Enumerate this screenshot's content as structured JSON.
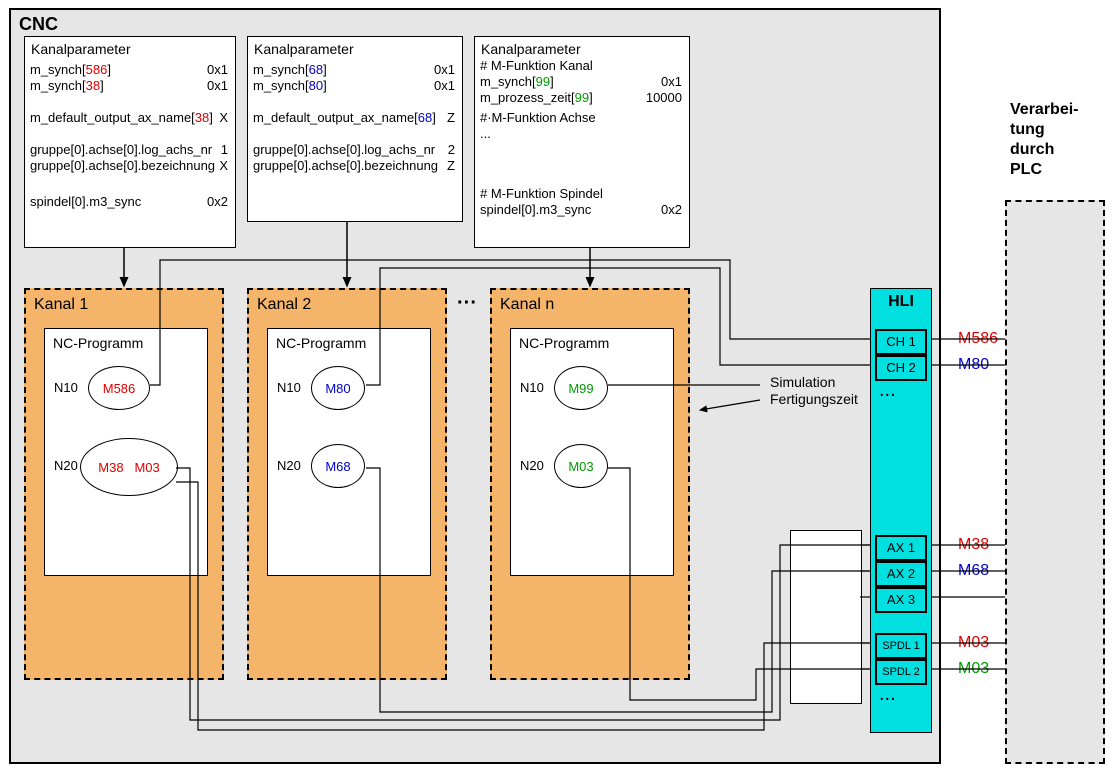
{
  "cnc": {
    "title": "CNC"
  },
  "params": [
    {
      "title": "Kanalparameter",
      "lines": [
        {
          "parts": [
            {
              "t": "m_synch[",
              "c": ""
            },
            {
              "t": "586",
              "c": "red"
            },
            {
              "t": "]",
              "c": ""
            }
          ],
          "val": "0x1"
        },
        {
          "parts": [
            {
              "t": "m_synch[",
              "c": ""
            },
            {
              "t": "38",
              "c": "red"
            },
            {
              "t": "]",
              "c": ""
            }
          ],
          "val": "0x1"
        },
        {
          "parts": [
            {
              "t": "m_default_output_ax_name[",
              "c": ""
            },
            {
              "t": "38",
              "c": "red"
            },
            {
              "t": "]",
              "c": ""
            }
          ],
          "val": "X"
        },
        {
          "parts": [
            {
              "t": "gruppe[0].achse[0].log_achs_nr",
              "c": ""
            }
          ],
          "val": "1"
        },
        {
          "parts": [
            {
              "t": "gruppe[0].achse[0].bezeichnung",
              "c": ""
            }
          ],
          "val": "X"
        },
        {
          "parts": [
            {
              "t": "spindel[0].m3_sync",
              "c": ""
            }
          ],
          "val": "0x2"
        }
      ]
    },
    {
      "title": "Kanalparameter",
      "lines": [
        {
          "parts": [
            {
              "t": "m_synch[",
              "c": ""
            },
            {
              "t": "68",
              "c": "blue"
            },
            {
              "t": "]",
              "c": ""
            }
          ],
          "val": "0x1"
        },
        {
          "parts": [
            {
              "t": "m_synch[",
              "c": ""
            },
            {
              "t": "80",
              "c": "blue"
            },
            {
              "t": "]",
              "c": ""
            }
          ],
          "val": "0x1"
        },
        {
          "parts": [
            {
              "t": "m_default_output_ax_name[",
              "c": ""
            },
            {
              "t": "68",
              "c": "blue"
            },
            {
              "t": "]",
              "c": ""
            }
          ],
          "val": "Z"
        },
        {
          "parts": [
            {
              "t": "gruppe[0].achse[0].log_achs_nr",
              "c": ""
            }
          ],
          "val": "2"
        },
        {
          "parts": [
            {
              "t": "gruppe[0].achse[0].bezeichnung",
              "c": ""
            }
          ],
          "val": "Z"
        }
      ]
    },
    {
      "title": "Kanalparameter",
      "lines": [
        {
          "parts": [
            {
              "t": "# M-Funktion Kanal",
              "c": ""
            }
          ],
          "val": ""
        },
        {
          "parts": [
            {
              "t": "m_synch[",
              "c": ""
            },
            {
              "t": "99",
              "c": "green"
            },
            {
              "t": "]",
              "c": ""
            }
          ],
          "val": "0x1"
        },
        {
          "parts": [
            {
              "t": "m_prozess_zeit[",
              "c": ""
            },
            {
              "t": "99",
              "c": "green"
            },
            {
              "t": "]",
              "c": ""
            }
          ],
          "val": "10000"
        },
        {
          "parts": [
            {
              "t": "#·M-Funktion Achse",
              "c": ""
            }
          ],
          "val": ""
        },
        {
          "parts": [
            {
              "t": "...",
              "c": ""
            }
          ],
          "val": ""
        },
        {
          "parts": [
            {
              "t": "# M-Funktion Spindel",
              "c": ""
            }
          ],
          "val": ""
        },
        {
          "parts": [
            {
              "t": "spindel[0].m3_sync",
              "c": ""
            }
          ],
          "val": "0x2"
        }
      ]
    }
  ],
  "kanals": [
    {
      "title": "Kanal 1",
      "nc": "NC-Programm",
      "rows": [
        {
          "n": "N10",
          "codes": [
            {
              "t": "M586",
              "c": "red"
            }
          ]
        },
        {
          "n": "N20",
          "codes": [
            {
              "t": "M38",
              "c": "red"
            },
            {
              "t": "M03",
              "c": "red"
            }
          ]
        }
      ]
    },
    {
      "title": "Kanal 2",
      "nc": "NC-Programm",
      "rows": [
        {
          "n": "N10",
          "codes": [
            {
              "t": "M80",
              "c": "blue"
            }
          ]
        },
        {
          "n": "N20",
          "codes": [
            {
              "t": "M68",
              "c": "blue"
            }
          ]
        }
      ]
    },
    {
      "title": "Kanal n",
      "nc": "NC-Programm",
      "rows": [
        {
          "n": "N10",
          "codes": [
            {
              "t": "M99",
              "c": "green"
            }
          ]
        },
        {
          "n": "N20",
          "codes": [
            {
              "t": "M03",
              "c": "green"
            }
          ]
        }
      ]
    }
  ],
  "between_kanals_ellipsis": "···",
  "simulation_label": "Simulation\nFertigungszeit",
  "hli": {
    "title": "HLI",
    "ch": [
      "CH 1",
      "CH 2"
    ],
    "ax": [
      "AX 1",
      "AX 2",
      "AX 3"
    ],
    "spdl": [
      "SPDL 1",
      "SPDL 2"
    ],
    "dots": "..."
  },
  "outputs": {
    "ch": [
      {
        "t": "M586",
        "c": "red"
      },
      {
        "t": "M80",
        "c": "blue"
      }
    ],
    "ax": [
      {
        "t": "M38",
        "c": "red"
      },
      {
        "t": "M68",
        "c": "blue"
      }
    ],
    "spdl": [
      {
        "t": "M03",
        "c": "red"
      },
      {
        "t": "M03",
        "c": "green"
      }
    ]
  },
  "plc": {
    "label": "Verarbei-\ntung\ndurch\nPLC"
  }
}
